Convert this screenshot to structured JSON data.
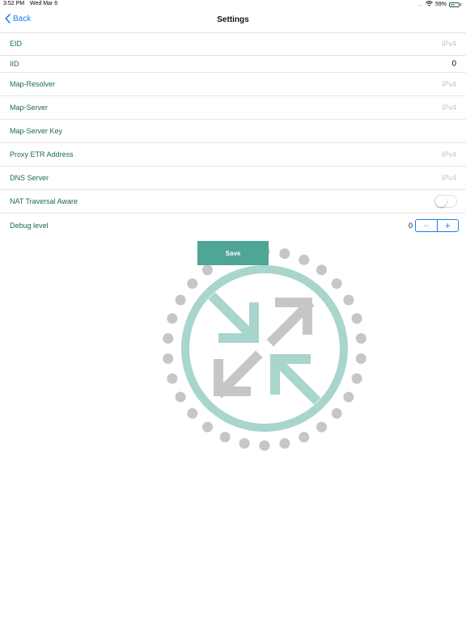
{
  "status_bar": {
    "time": "3:52 PM",
    "date": "Wed Mar 6",
    "signal": "....",
    "battery_percent_label": "59%",
    "battery_level": 0.59
  },
  "nav": {
    "back_label": "Back",
    "title": "Settings"
  },
  "rows": {
    "eid": {
      "label": "EID",
      "value": "",
      "placeholder": "IPv4"
    },
    "iid": {
      "label": "IID",
      "value": "0",
      "placeholder": ""
    },
    "map_resolver": {
      "label": "Map-Resolver",
      "value": "",
      "placeholder": "IPv4"
    },
    "map_server": {
      "label": "Map-Server",
      "value": "",
      "placeholder": "IPv4"
    },
    "map_server_key": {
      "label": "Map-Server Key",
      "value": "",
      "placeholder": ""
    },
    "proxy_etr": {
      "label": "Proxy ETR Address",
      "value": "",
      "placeholder": "IPv4"
    },
    "dns_server": {
      "label": "DNS Server",
      "value": "",
      "placeholder": "IPv4"
    },
    "nat_traversal": {
      "label": "NAT Traversal Aware",
      "enabled": false
    },
    "debug_level": {
      "label": "Debug level",
      "value": "0",
      "minus": "−",
      "plus": "+"
    }
  },
  "save_button": {
    "label": "Save"
  },
  "colors": {
    "accent_blue": "#1a7cf5",
    "label_green": "#1f6a51",
    "save_green": "#4fa596",
    "logo_teal": "#a8d5cc",
    "logo_gray": "#c6c6c6"
  },
  "icons": {
    "back": "chevron-left-icon",
    "wifi": "wifi-icon",
    "battery": "battery-icon",
    "logo": "network-arrows-logo"
  }
}
